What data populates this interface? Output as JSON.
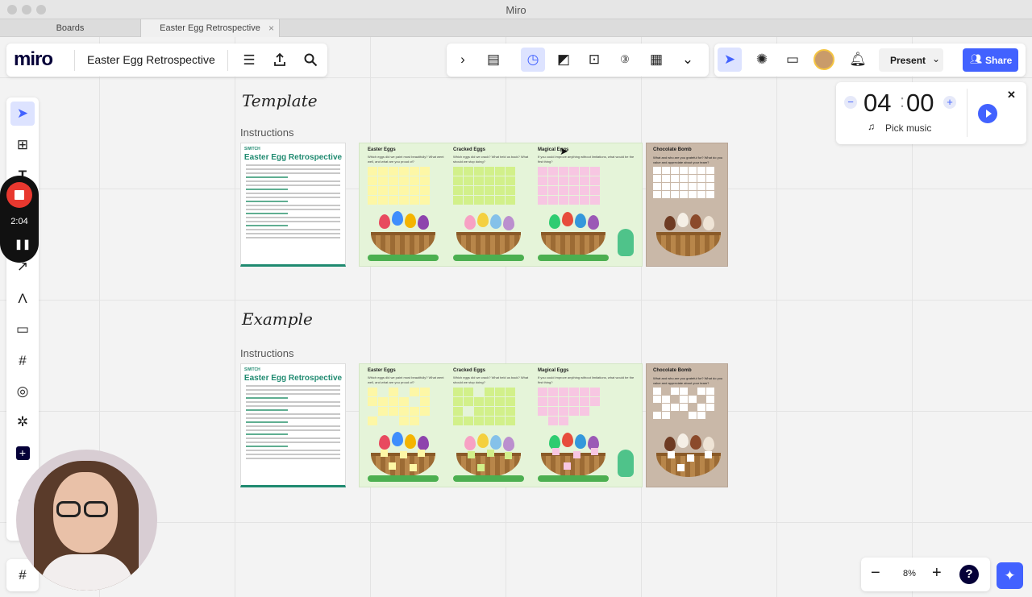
{
  "window": {
    "title": "Miro"
  },
  "browser_tabs": [
    {
      "label": "Boards"
    },
    {
      "label": "Easter Egg Retrospective",
      "close": "×"
    }
  ],
  "header": {
    "logo": "miro",
    "board_name": "Easter Egg Retrospective"
  },
  "top_toolbar": {
    "present_label": "Present",
    "share_label": "Share"
  },
  "timer": {
    "minutes": "04",
    "separator": ":",
    "seconds": "00",
    "pick_music": "Pick music",
    "minus": "−",
    "plus": "+",
    "close": "✕"
  },
  "recording": {
    "time": "2:04"
  },
  "zoom": {
    "level": "8%",
    "minus": "−",
    "plus": "+",
    "help": "?"
  },
  "sections": [
    {
      "heading": "Template",
      "instructions": "Instructions"
    },
    {
      "heading": "Example",
      "instructions": "Instructions"
    }
  ],
  "doc": {
    "brand": "SWITCH",
    "title": "Easter Egg Retrospective"
  },
  "columns": [
    {
      "title": "Easter Eggs",
      "subtitle": "Which eggs did we paint most beautifully? What went well, and what are you proud of?"
    },
    {
      "title": "Cracked Eggs",
      "subtitle": "Which eggs did we crack? What held us back? What should we stop doing?"
    },
    {
      "title": "Magical Eggs",
      "subtitle": "If you could improve anything without limitations, what would be the first thing?"
    }
  ],
  "choc": {
    "title": "Chocolate Bomb",
    "subtitle": "What and who are you grateful for? What do you value and appreciate about your team?"
  },
  "colors": {
    "accent": "#4262ff",
    "record": "#e8382f",
    "yellow": "#fdf7a6",
    "green": "#d2f08a",
    "pink": "#f7c6e2",
    "board_bg": "#e5f4d9"
  }
}
